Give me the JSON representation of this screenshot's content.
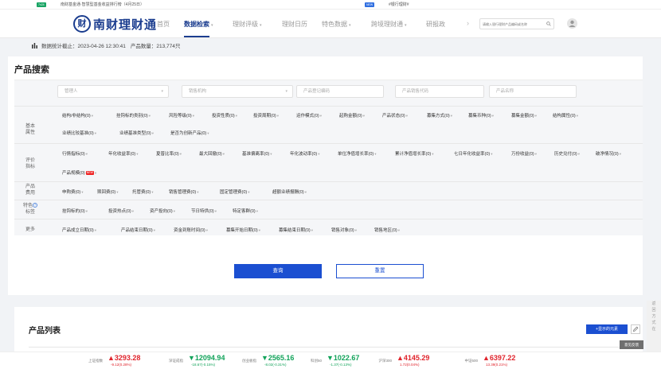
{
  "topbar": {
    "tag1": "7x24",
    "text1": "南财基金通·智慧型基金收益排行榜（4月25日）",
    "tag2": "NEW",
    "text2": "#银行理财#"
  },
  "nav": {
    "logo_mark": "财",
    "logo_text": "南财理财通",
    "items": [
      "首页",
      "数据检索",
      "理财评级",
      "理财日历",
      "特色数据",
      "跨境理财通",
      "研报政"
    ],
    "search_placeholder": "请输入银行理财产品编码或名称"
  },
  "stats": {
    "label": "数据统计截止：2023-04-26 12:30:41",
    "count": "产品数量：213,774只"
  },
  "search_panel": {
    "title": "产品搜索",
    "inputs": [
      "管理人",
      "销售机构",
      "产品登记编码",
      "产品销售代码",
      "产品名称"
    ],
    "row_labels": {
      "basic": "基本\n属性",
      "rating": "评价\n指标",
      "fee": "产品\n费用",
      "feature": "特色",
      "feature2": "标签",
      "more": "更多"
    },
    "basic_row1": [
      "结构/非结构(0)",
      "挂钩标的类别(0)",
      "风险等级(0)",
      "投资性质(0)",
      "投资周期(0)",
      "运作模式(0)",
      "起购金额(0)",
      "产品状态(0)",
      "募集方式(0)",
      "募集币种(0)",
      "募集金额(0)",
      "结构属性(0)"
    ],
    "basic_row2": [
      "业绩比较基准(0)",
      "业绩基准类型(0)",
      "是否为创新产品(0)"
    ],
    "rating_row1": [
      "行情指标(0)",
      "年化收益率(0)",
      "夏普比率(0)",
      "最大回撤(0)",
      "基准偏离率(0)",
      "年化波动率(0)",
      "单位净值增长率(0)",
      "累计净值增长率(0)",
      "七日年化收益率(0)",
      "万份收益(0)",
      "历史兑付(0)",
      "破净情况(0)"
    ],
    "rating_row2": "产品规模(0)",
    "new_badge": "NEW",
    "fee_row": [
      "申购费(0)",
      "赎回费(0)",
      "托管费(0)",
      "销售管理费(0)",
      "固定管理费(0)",
      "超额业绩报酬(0)"
    ],
    "feature_row": [
      "挂钩标的(0)",
      "投资热点(0)",
      "资产投向(0)",
      "节日特供(0)",
      "特定客群(0)"
    ],
    "more_row": [
      "产品成立日期(0)",
      "产品结束日期(0)",
      "资金到账时间(0)",
      "募集开始日期(0)",
      "募集结束日期(0)",
      "销售对象(0)",
      "销售地区(0)"
    ],
    "query_label": "查询",
    "reset_label": "重置"
  },
  "list_panel": {
    "title": "产品列表",
    "show_button": "+显示的元素",
    "feedback": "意见反馈"
  },
  "side_tools": [
    "返",
    "回",
    "方",
    "式",
    "在"
  ],
  "ticker": [
    {
      "name": "上证指数",
      "value": "▲3293.28",
      "change": "-9.12(0.28%)",
      "dir": "up"
    },
    {
      "name": "深证成指",
      "value": "▼12094.94",
      "change": "-18.67(-0.15%)",
      "dir": "down"
    },
    {
      "name": "创业板指",
      "value": "▼2565.16",
      "change": "-8.02(-0.31%)",
      "dir": "down"
    },
    {
      "name": "科创50",
      "value": "▼1022.67",
      "change": "-1.37(-0.13%)",
      "dir": "down"
    },
    {
      "name": "沪深300",
      "value": "▲4145.29",
      "change": "1.72(0.04%)",
      "dir": "up"
    },
    {
      "name": "中证500",
      "value": "▲6397.22",
      "change": "13.39(0.21%)",
      "dir": "up"
    }
  ]
}
